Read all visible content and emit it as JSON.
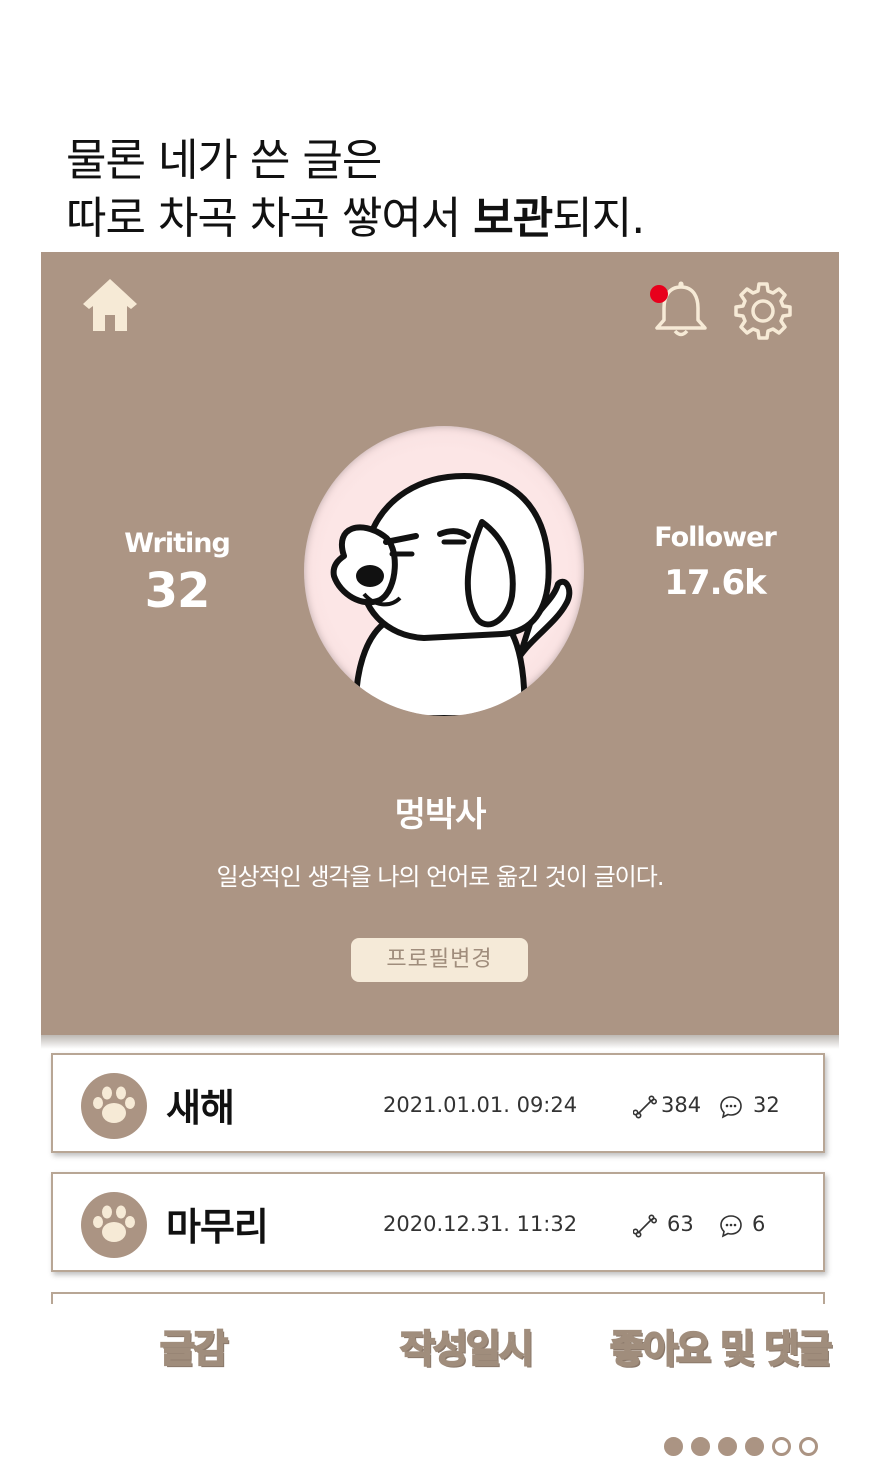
{
  "headline": {
    "line1": "물론 네가 쓴 글은",
    "line2_prefix": "따로 차곡 차곡 쌓여서 ",
    "line2_bold": "보관",
    "line2_suffix": "되지."
  },
  "profile": {
    "writing_label": "Writing",
    "writing_count": "32",
    "follower_label": "Follower",
    "follower_count": "17.6k",
    "username": "멍박사",
    "bio": "일상적인 생각을 나의 언어로 옮긴 것이 글이다.",
    "edit_button": "프로필변경"
  },
  "header_icons": [
    "home-icon",
    "bell-icon",
    "gear-icon"
  ],
  "posts": [
    {
      "title": "새해",
      "date": "2021.01.01. 09:24",
      "likes": "384",
      "comments": "32"
    },
    {
      "title": "마무리",
      "date": "2020.12.31. 11:32",
      "likes": "63",
      "comments": "6"
    }
  ],
  "annotations": {
    "label1": "글감",
    "label2": "작성일시",
    "label3": "좋아요 및 댓글"
  },
  "pagination": {
    "total": 6,
    "filled": 4
  },
  "colors": {
    "panel": "#ac9584",
    "icon": "#f6ead6",
    "badge": "#ab9483",
    "card_border": "#b8a695",
    "notification_dot": "#e8001c"
  }
}
